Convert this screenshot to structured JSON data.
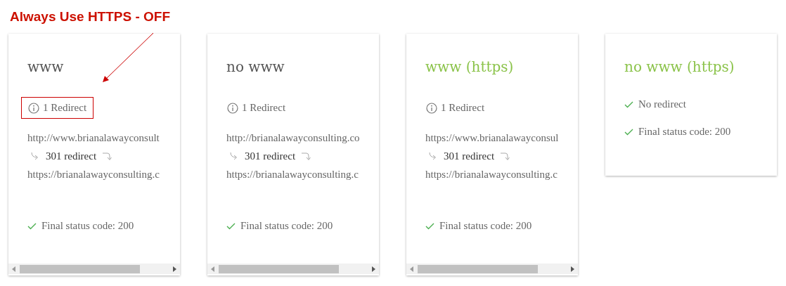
{
  "annotation": {
    "text": "Always Use HTTPS - OFF"
  },
  "cards": [
    {
      "title": "www",
      "secure": false,
      "kind": "redirect",
      "highlighted": true,
      "redirect_count": "1 Redirect",
      "from_url": "http://www.brianalawayconsult",
      "redirect_label": "301 redirect",
      "to_url": "https://brianalawayconsulting.c",
      "final_status": "Final status code: 200"
    },
    {
      "title": "no www",
      "secure": false,
      "kind": "redirect",
      "highlighted": false,
      "redirect_count": "1 Redirect",
      "from_url": "http://brianalawayconsulting.co",
      "redirect_label": "301 redirect",
      "to_url": "https://brianalawayconsulting.c",
      "final_status": "Final status code: 200"
    },
    {
      "title": "www (https)",
      "secure": true,
      "kind": "redirect",
      "highlighted": false,
      "redirect_count": "1 Redirect",
      "from_url": "https://www.brianalawayconsul",
      "redirect_label": "301 redirect",
      "to_url": "https://brianalawayconsulting.c",
      "final_status": "Final status code: 200"
    },
    {
      "title": "no www (https)",
      "secure": true,
      "kind": "direct",
      "highlighted": false,
      "redirect_count": "No redirect",
      "final_status": "Final status code: 200"
    }
  ]
}
